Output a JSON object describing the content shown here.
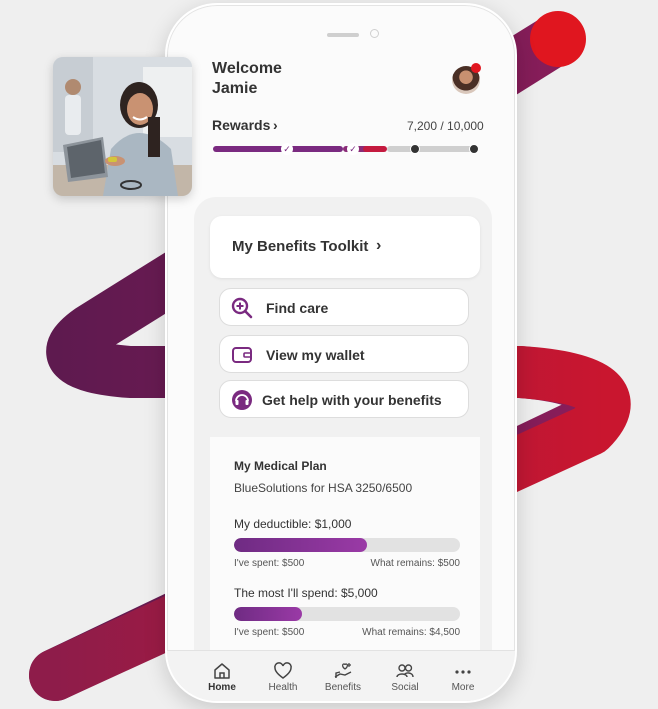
{
  "greeting": {
    "line1": "Welcome",
    "line2": "Jamie"
  },
  "rewards": {
    "label": "Rewards",
    "chevron": "›",
    "value": "7,200 / 10,000",
    "progress": 0.72
  },
  "toolkit": {
    "title": "My Benefits Toolkit",
    "chevron": "›"
  },
  "actions": [
    {
      "label": "Find care",
      "icon": "search-plus-icon"
    },
    {
      "label": "View my wallet",
      "icon": "wallet-icon"
    },
    {
      "label": "Get help with your benefits",
      "icon": "headset-icon"
    }
  ],
  "medical_plan": {
    "title": "My Medical Plan",
    "plan_name": "BlueSolutions for HSA 3250/6500",
    "deductible": {
      "label": "My deductible: $1,000",
      "spent": "I've spent: $500",
      "remains": "What remains: $500",
      "fraction": 0.59
    },
    "max_spend": {
      "label": "The most I'll spend: $5,000",
      "spent": "I've spent: $500",
      "remains": "What remains: $4,500",
      "fraction": 0.3
    }
  },
  "tabs": [
    {
      "label": "Home",
      "icon": "home-icon",
      "active": true
    },
    {
      "label": "Health",
      "icon": "heart-icon",
      "active": false
    },
    {
      "label": "Benefits",
      "icon": "hand-heart-icon",
      "active": false
    },
    {
      "label": "Social",
      "icon": "people-icon",
      "active": false
    },
    {
      "label": "More",
      "icon": "more-dots-icon",
      "active": false
    }
  ],
  "colors": {
    "brand_red": "#e0161f",
    "brand_purple": "#7a2a80",
    "track_gray": "#e2e2e2",
    "background": "#efefef"
  }
}
